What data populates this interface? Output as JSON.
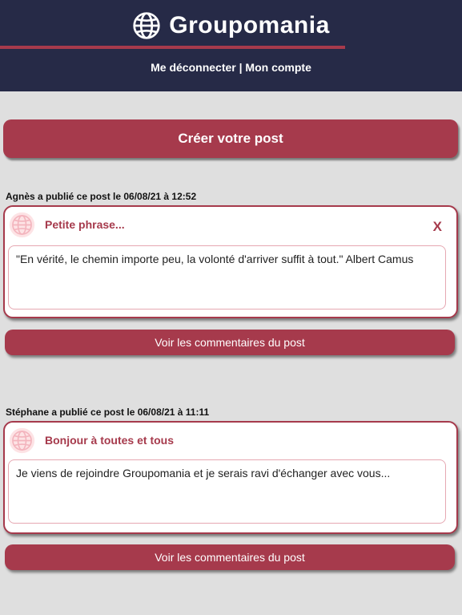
{
  "header": {
    "brand": "Groupomania",
    "logout_label": "Me déconnecter",
    "separator": "|",
    "account_label": "Mon compte"
  },
  "create_post_label": "Créer votre post",
  "posts": [
    {
      "meta": "Agnès a publié ce post le 06/08/21 à 12:52",
      "title": "Petite phrase...",
      "delete_label": "X",
      "content": "\"En vérité, le chemin importe peu, la volonté d'arriver suffit à tout.\" Albert Camus",
      "comments_label": "Voir les commentaires du post"
    },
    {
      "meta": "Stéphane a publié ce post le 06/08/21 à 11:11",
      "title": "Bonjour à toutes et tous",
      "content": "Je viens de rejoindre Groupomania et je serais ravi d'échanger avec vous...",
      "comments_label": "Voir les commentaires du post"
    }
  ],
  "colors": {
    "header_bg": "#262a47",
    "accent": "#a63a4c",
    "page_bg": "#dfdfdf"
  },
  "icons": {
    "logo": "globe-icon",
    "post_avatar": "globe-icon"
  }
}
